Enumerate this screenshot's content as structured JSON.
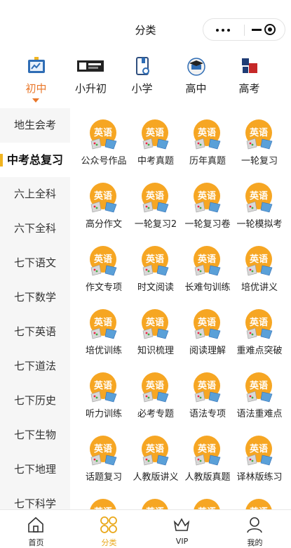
{
  "header": {
    "title": "分类"
  },
  "levels": [
    {
      "label": "初中",
      "icon": "chalkboard-icon",
      "active": true
    },
    {
      "label": "小升初",
      "icon": "banner-icon",
      "active": false
    },
    {
      "label": "小学",
      "icon": "phone-book-icon",
      "active": false
    },
    {
      "label": "高中",
      "icon": "graduation-cap-icon",
      "active": false
    },
    {
      "label": "高考",
      "icon": "exam-badge-icon",
      "active": false
    }
  ],
  "sidebar": {
    "items": [
      {
        "label": "地生会考",
        "active": false
      },
      {
        "label": "中考总复习",
        "active": true
      },
      {
        "label": "六上全科",
        "active": false
      },
      {
        "label": "六下全科",
        "active": false
      },
      {
        "label": "七下语文",
        "active": false
      },
      {
        "label": "七下数学",
        "active": false
      },
      {
        "label": "七下英语",
        "active": false
      },
      {
        "label": "七下道法",
        "active": false
      },
      {
        "label": "七下历史",
        "active": false
      },
      {
        "label": "七下生物",
        "active": false
      },
      {
        "label": "七下地理",
        "active": false
      },
      {
        "label": "七下科学",
        "active": false
      }
    ]
  },
  "badge_text": "英语",
  "colors": {
    "accent": "#e9772a",
    "badge_orange": "#f6a623",
    "badge_yellow": "#f9c83a",
    "marker": "#f1b420"
  },
  "grid": {
    "items": [
      "公众号作品",
      "中考真题",
      "历年真题",
      "一轮复习",
      "高分作文",
      "一轮复习2",
      "一轮复习卷",
      "一轮模拟考",
      "作文专项",
      "时文阅读",
      "长难句训练",
      "培优讲义",
      "培优训练",
      "知识梳理",
      "阅读理解",
      "重难点突破",
      "听力训练",
      "必考专题",
      "语法专项",
      "语法重难点",
      "话题复习",
      "人教版讲义",
      "人教版真题",
      "译林版练习",
      "",
      "",
      "",
      ""
    ]
  },
  "tabbar": {
    "tabs": [
      {
        "label": "首页",
        "icon": "home-icon",
        "active": false
      },
      {
        "label": "分类",
        "icon": "category-icon",
        "active": true
      },
      {
        "label": "VIP",
        "icon": "crown-icon",
        "active": false
      },
      {
        "label": "我的",
        "icon": "profile-icon",
        "active": false
      }
    ]
  }
}
